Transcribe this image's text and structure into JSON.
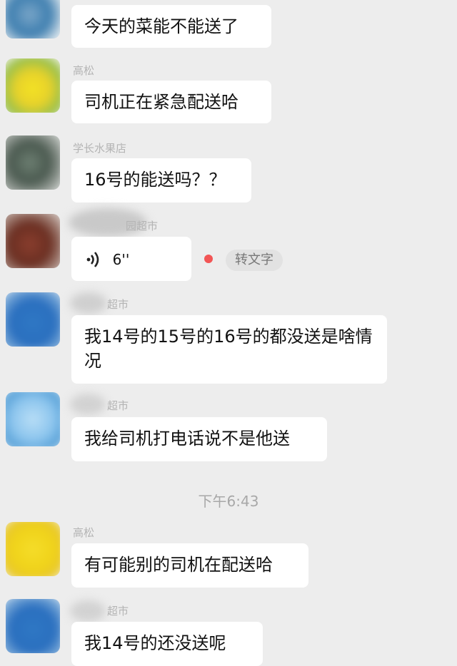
{
  "messages": [
    {
      "sender": "",
      "text": "今天的菜能不能送了",
      "avatar_color": "#5b8fb8"
    },
    {
      "sender": "高松",
      "text": "司机正在紧急配送哈",
      "avatar_color": "#e8d22a"
    },
    {
      "sender": "学长水果店",
      "text": "16号的能送吗？？",
      "avatar_color": "#5a6b60"
    },
    {
      "sender": "园超市",
      "voice_duration": "6''",
      "to_text_label": "转文字",
      "avatar_color": "#7a3a2c"
    },
    {
      "sender": "超市",
      "text": "我14号的15号的16号的都没送是啥情况",
      "avatar_color": "#2a6fbf"
    },
    {
      "sender": "超市",
      "text": "我给司机打电话说不是他送",
      "avatar_color": "#8ec6ee"
    },
    {
      "sender": "高松",
      "text": "有可能别的司机在配送哈",
      "avatar_color": "#f0d31a"
    },
    {
      "sender": "超市",
      "text": "我14号的还没送呢",
      "avatar_color": "#2a6fbf"
    }
  ],
  "timestamp": "下午6:43",
  "icons": {
    "voice": "voice-wave-icon",
    "unread": "unread-dot"
  },
  "colors": {
    "background": "#ededed",
    "bubble": "#ffffff",
    "unread": "#f25555"
  }
}
